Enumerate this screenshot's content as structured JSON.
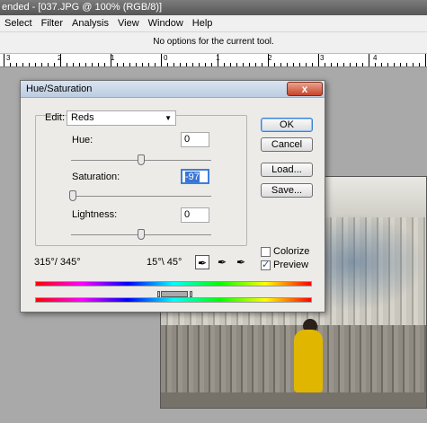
{
  "window": {
    "title": "ended - [037.JPG @ 100% (RGB/8)]"
  },
  "menu": [
    "Select",
    "Filter",
    "Analysis",
    "View",
    "Window",
    "Help"
  ],
  "options_bar": {
    "text": "No options for the current tool."
  },
  "ruler": {
    "numbers": [
      "3",
      "2",
      "1",
      "0",
      "1",
      "2",
      "3",
      "4"
    ]
  },
  "dialog": {
    "title": "Hue/Saturation",
    "close_label": "x",
    "edit_label": "Edit:",
    "edit_value": "Reds",
    "hue_label": "Hue:",
    "hue_value": "0",
    "saturation_label": "Saturation:",
    "saturation_value": "-97",
    "lightness_label": "Lightness:",
    "lightness_value": "0",
    "range_left": "315°/ 345°",
    "range_right": "15°\\ 45°",
    "ok_label": "OK",
    "cancel_label": "Cancel",
    "load_label": "Load...",
    "save_label": "Save...",
    "colorize_label": "Colorize",
    "colorize_checked": false,
    "preview_label": "Preview",
    "preview_checked": true,
    "sliders": {
      "hue": 0,
      "saturation": -97,
      "lightness": 0
    }
  }
}
